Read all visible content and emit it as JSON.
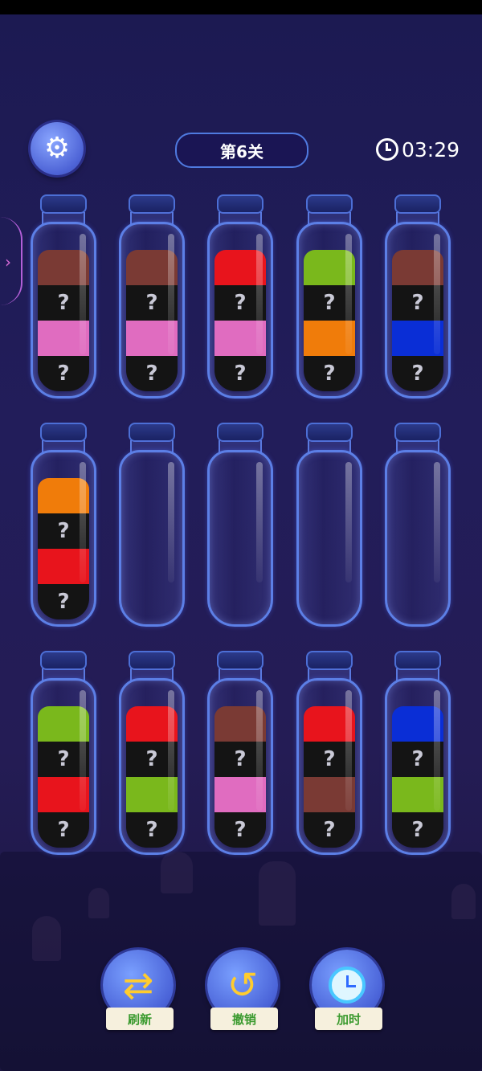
{
  "header": {
    "settings_icon": "gear-icon",
    "level_label": "第6关",
    "timer_icon": "alarm-clock-icon",
    "timer_value": "03:29"
  },
  "tubes": [
    {
      "layers": [
        {
          "hidden": true
        },
        {
          "color": "#e06cc0"
        },
        {
          "hidden": true
        },
        {
          "color": "#7a3a34"
        }
      ]
    },
    {
      "layers": [
        {
          "hidden": true
        },
        {
          "color": "#e06cc0"
        },
        {
          "hidden": true
        },
        {
          "color": "#7a3a34"
        }
      ]
    },
    {
      "layers": [
        {
          "hidden": true
        },
        {
          "color": "#e06cc0"
        },
        {
          "hidden": true
        },
        {
          "color": "#e8141c"
        }
      ]
    },
    {
      "layers": [
        {
          "hidden": true
        },
        {
          "color": "#f07c0a"
        },
        {
          "hidden": true
        },
        {
          "color": "#7ab81c"
        }
      ]
    },
    {
      "layers": [
        {
          "hidden": true
        },
        {
          "color": "#0a2ed6"
        },
        {
          "hidden": true
        },
        {
          "color": "#7a3a34"
        }
      ]
    },
    {
      "layers": [
        {
          "hidden": true
        },
        {
          "color": "#e8141c"
        },
        {
          "hidden": true
        },
        {
          "color": "#f07c0a"
        }
      ]
    },
    {
      "layers": []
    },
    {
      "layers": []
    },
    {
      "layers": []
    },
    {
      "layers": []
    },
    {
      "layers": [
        {
          "hidden": true
        },
        {
          "color": "#e8141c"
        },
        {
          "hidden": true
        },
        {
          "color": "#7ab81c"
        }
      ]
    },
    {
      "layers": [
        {
          "hidden": true
        },
        {
          "color": "#7ab81c"
        },
        {
          "hidden": true
        },
        {
          "color": "#e8141c"
        }
      ]
    },
    {
      "layers": [
        {
          "hidden": true
        },
        {
          "color": "#e06cc0"
        },
        {
          "hidden": true
        },
        {
          "color": "#7a3a34"
        }
      ]
    },
    {
      "layers": [
        {
          "hidden": true
        },
        {
          "color": "#7a3a34"
        },
        {
          "hidden": true
        },
        {
          "color": "#e8141c"
        }
      ]
    },
    {
      "layers": [
        {
          "hidden": true
        },
        {
          "color": "#7ab81c"
        },
        {
          "hidden": true
        },
        {
          "color": "#0a2ed6"
        }
      ]
    }
  ],
  "hidden_mark": "?",
  "colors": {
    "hidden_layer": "#141414",
    "accent_blue": "#4f7ae0",
    "label_green": "#3a9a2e"
  },
  "actions": {
    "refresh": {
      "label": "刷新",
      "icon": "refresh-arrows-icon"
    },
    "undo": {
      "label": "撤销",
      "icon": "undo-arrow-icon"
    },
    "add_time": {
      "label": "加时",
      "icon": "alarm-clock-icon"
    }
  }
}
